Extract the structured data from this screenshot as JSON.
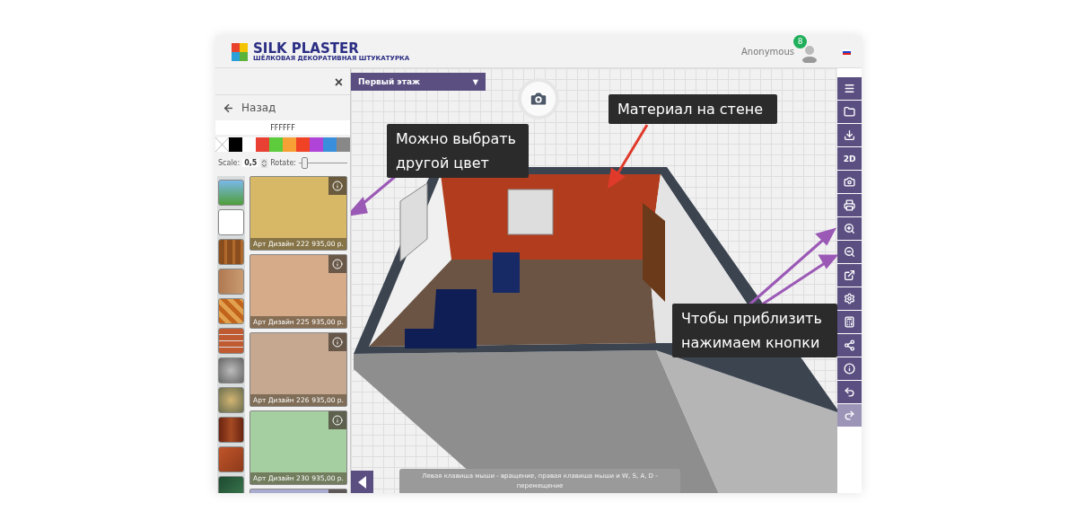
{
  "header": {
    "logo_title": "SILK PLASTER",
    "logo_subtitle": "ШЁЛКОВАЯ ДЕКОРАТИВНАЯ ШТУКАТУРКА",
    "user": "Anonymous",
    "badge": "8"
  },
  "panel": {
    "close": "×",
    "back": "Назад",
    "color_code": "FFFFFF",
    "swatches": [
      {
        "kind": "none",
        "color": "#ffffff"
      },
      {
        "kind": "color",
        "color": "#000000"
      },
      {
        "kind": "color",
        "color": "#ffffff"
      },
      {
        "kind": "color",
        "color": "#e84133"
      },
      {
        "kind": "color",
        "color": "#5ccc3c"
      },
      {
        "kind": "color",
        "color": "#f7a035"
      },
      {
        "kind": "color",
        "color": "#f04224"
      },
      {
        "kind": "color",
        "color": "#b144d8"
      },
      {
        "kind": "color",
        "color": "#3a8fdc"
      },
      {
        "kind": "color",
        "color": "#888888"
      }
    ],
    "scale_label": "Scale:",
    "scale_value": "0,5",
    "rotate_label": "Rotate:",
    "rotate": {
      "level": 0.05
    },
    "materials": [
      {
        "name": "Арт Дизайн 222",
        "price": "935,00 р.",
        "color": "#d7b866"
      },
      {
        "name": "Арт Дизайн 225",
        "price": "935,00 р.",
        "color": "#d6ab8a"
      },
      {
        "name": "Арт Дизайн 226",
        "price": "935,00 р.",
        "color": "#c6a790"
      },
      {
        "name": "Арт Дизайн 230",
        "price": "935,00 р.",
        "color": "#a5cfa1"
      },
      {
        "color": "#a9accf"
      }
    ]
  },
  "canvas": {
    "floor": "Первый этаж",
    "floor_caret": "▼",
    "hint": "Левая клавиша мыши - вращение, правая клавиша мыши и W, S, A, D - перемещение",
    "callouts": [
      {
        "text": "Можно выбрать другой цвет"
      },
      {
        "text": "Материал на стене"
      },
      {
        "text": "Чтобы приблизить нажимаем кнопки"
      }
    ]
  },
  "toolbar": [
    {
      "kind": "menu",
      "disabled": false
    },
    {
      "kind": "open",
      "disabled": false
    },
    {
      "kind": "download",
      "disabled": false
    },
    {
      "kind": "text",
      "label": "2D",
      "disabled": false
    },
    {
      "kind": "camera",
      "disabled": false
    },
    {
      "kind": "print",
      "disabled": false
    },
    {
      "kind": "zoom-in",
      "disabled": false
    },
    {
      "kind": "zoom-out",
      "disabled": false
    },
    {
      "kind": "external",
      "disabled": false
    },
    {
      "kind": "settings",
      "disabled": false
    },
    {
      "kind": "calculator",
      "disabled": false
    },
    {
      "kind": "share",
      "disabled": false
    },
    {
      "kind": "info",
      "disabled": false
    },
    {
      "kind": "undo",
      "disabled": false
    },
    {
      "kind": "redo",
      "disabled": true
    }
  ]
}
